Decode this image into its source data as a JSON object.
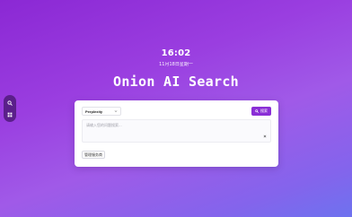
{
  "side_rail": {
    "items": [
      {
        "icon": "search-icon"
      },
      {
        "icon": "grid-icon"
      }
    ]
  },
  "clock": {
    "time": "16:02",
    "date": "11月18日星期一"
  },
  "title": "Onion AI Search",
  "search": {
    "model": "Perplexity",
    "button_label": "搜索",
    "placeholder": "请输入您的问题搜索..."
  },
  "actions": {
    "manage_label": "管理服务商"
  },
  "colors": {
    "accent": "#8a2fd6",
    "rail": "#5a1f8a"
  }
}
